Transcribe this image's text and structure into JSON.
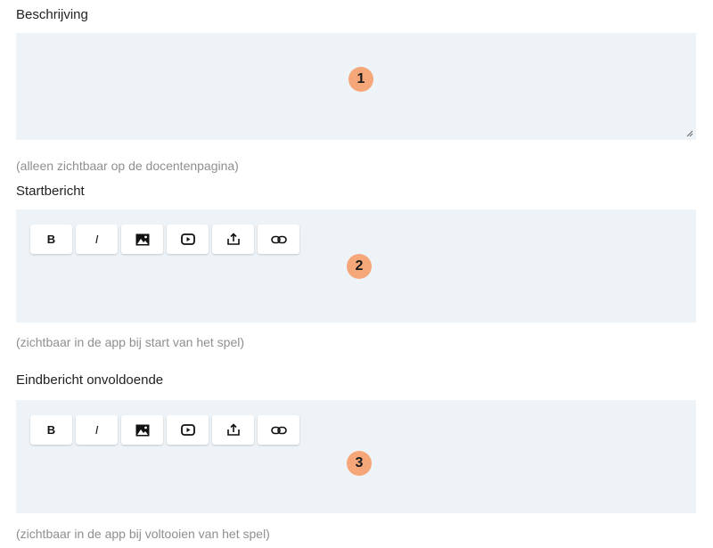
{
  "fields": [
    {
      "label": "Beschrijving",
      "hint": "(alleen zichtbaar op de docentenpagina)",
      "badge": "1",
      "value": ""
    },
    {
      "label": "Startbericht",
      "hint": "(zichtbaar in de app bij start van het spel)",
      "badge": "2",
      "toolbar": {
        "bold": "B",
        "italic": "I",
        "image_icon": "image-icon",
        "video_icon": "play-video-icon",
        "upload_icon": "upload-icon",
        "link_icon": "link-icon"
      }
    },
    {
      "label": "Eindbericht onvoldoende",
      "hint": "(zichtbaar in de app bij voltooien van het spel)",
      "badge": "3",
      "toolbar": {
        "bold": "B",
        "italic": "I",
        "image_icon": "image-icon",
        "video_icon": "play-video-icon",
        "upload_icon": "upload-icon",
        "link_icon": "link-icon"
      }
    }
  ],
  "colors": {
    "panel_bg": "#edf3f7",
    "badge": "#f6a77a",
    "label": "#222222",
    "hint": "#8f8f8f"
  }
}
